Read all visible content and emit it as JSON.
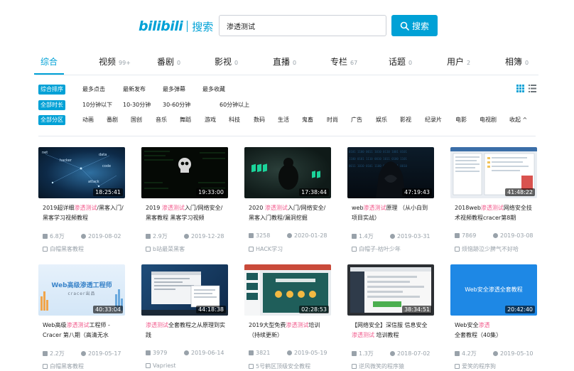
{
  "logo": {
    "mark": "bilibili",
    "text": "搜索"
  },
  "search": {
    "value": "渗透测试",
    "button_label": "搜索"
  },
  "colors": {
    "accent": "#00a1d6",
    "highlight": "#f25d8e",
    "muted": "#99a2aa"
  },
  "tabs": [
    {
      "label": "综合",
      "count": ""
    },
    {
      "label": "视频",
      "count": "99+"
    },
    {
      "label": "番剧",
      "count": "0"
    },
    {
      "label": "影视",
      "count": "0"
    },
    {
      "label": "直播",
      "count": "0"
    },
    {
      "label": "专栏",
      "count": "67"
    },
    {
      "label": "话题",
      "count": "0"
    },
    {
      "label": "用户",
      "count": "2"
    },
    {
      "label": "相簿",
      "count": "0"
    }
  ],
  "filters": {
    "sort": [
      "综合排序",
      "最多点击",
      "最新发布",
      "最多弹幕",
      "最多收藏"
    ],
    "duration": [
      "全部时长",
      "10分钟以下",
      "10-30分钟",
      "30-60分钟",
      "60分钟以上"
    ],
    "zone": [
      "全部分区",
      "动画",
      "番剧",
      "国创",
      "音乐",
      "舞蹈",
      "游戏",
      "科技",
      "数码",
      "生活",
      "鬼畜",
      "时尚",
      "广告",
      "娱乐",
      "影视",
      "纪录片",
      "电影",
      "电视剧",
      "收起 ^"
    ]
  },
  "videos": [
    {
      "duration": "18:25:41",
      "title_pre": "2019超详细",
      "title_hl": "渗透测试",
      "title_post": "/黑客入门/黑客学习视频教程",
      "views": "6.8万",
      "date": "2019-08-02",
      "author": "白帽黑客教程"
    },
    {
      "duration": "19:33:00",
      "title_pre": "2019 ",
      "title_hl": "渗透测试",
      "title_post": "入门/网络安全/黑客教程 黑客学习视频",
      "views": "2.9万",
      "date": "2019-12-28",
      "author": "b站最菜黑客"
    },
    {
      "duration": "17:38:44",
      "title_pre": "2020 ",
      "title_hl": "渗透测试",
      "title_post": "入门/网络安全/黑客入门教程/漏洞挖掘",
      "views": "3258",
      "date": "2020-01-28",
      "author": "HACK学习"
    },
    {
      "duration": "47:19:43",
      "title_pre": "web",
      "title_hl": "渗透测试",
      "title_post": "原理 （从小白到项目实战）",
      "views": "1.4万",
      "date": "2019-03-31",
      "author": "白帽子-枯叶少年"
    },
    {
      "duration": "41:48:22",
      "title_pre": "2018web",
      "title_hl": "渗透测试",
      "title_post": "网络安全技术视频教程cracer第8期",
      "views": "7869",
      "date": "2019-03-08",
      "author": "烦恼跡泣少脾气不好哈"
    },
    {
      "duration": "40:33:04",
      "title_pre": "Web高级",
      "title_hl": "渗透测试",
      "title_post": "工程师 - Cracer 第八期（高清无水",
      "views": "2.2万",
      "date": "2019-05-17",
      "author": "白帽黑客教程"
    },
    {
      "duration": "44:18:38",
      "title_pre": "",
      "title_hl": "渗透测试",
      "title_post": "全套教程之从原理到实践",
      "views": "3979",
      "date": "2019-06-14",
      "author": "Vapriest"
    },
    {
      "duration": "02:28:53",
      "title_pre": "2019大型免费",
      "title_hl": "渗透测试",
      "title_post": "培训（持续更新）",
      "views": "3821",
      "date": "2019-05-19",
      "author": "5号鹤区顶级安全教程"
    },
    {
      "duration": "38:34:51",
      "title_pre": "【网络安全】深信服 信息安全",
      "title_hl": "渗透测试",
      "title_post": " 培训教程",
      "views": "1.3万",
      "date": "2018-07-02",
      "author": "逆风微笑的程序猿"
    },
    {
      "duration": "20:42:40",
      "title_pre": "Web安全",
      "title_hl": "渗透",
      "title_post": "全套教程（40集）",
      "views": "4.2万",
      "date": "2019-05-10",
      "author": "爱笑的程序狗"
    }
  ],
  "thumb_texts": {
    "t6_line1": "Web高级渗透工程师",
    "t6_line2": "cracer出品",
    "t10": "Web安全渗透全套教程"
  }
}
